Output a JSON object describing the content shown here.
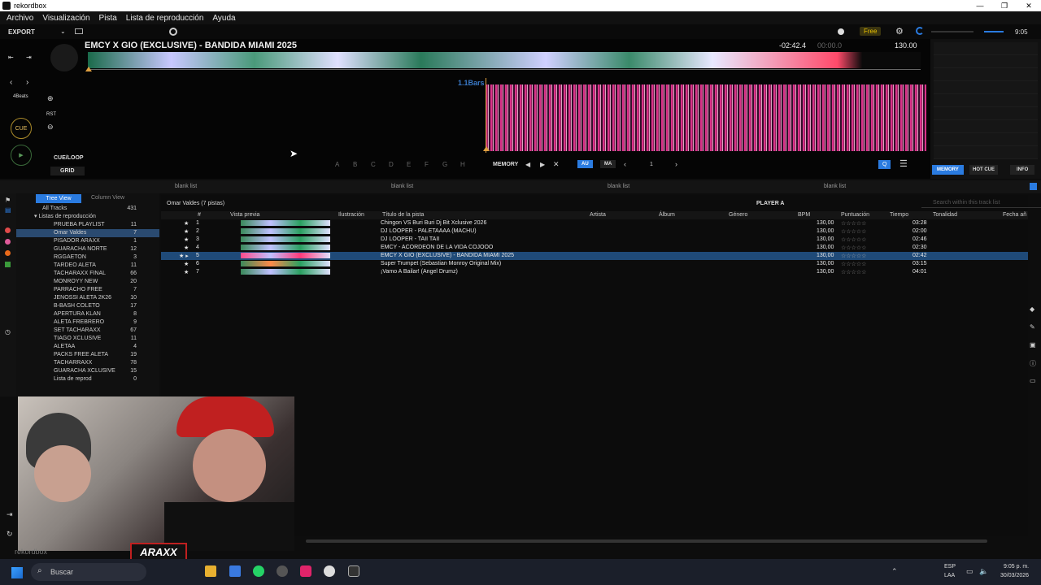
{
  "window": {
    "title": "rekordbox",
    "minimize": "—",
    "restore": "❐",
    "close": "✕"
  },
  "menu": [
    "Archivo",
    "Visualización",
    "Pista",
    "Lista de reproducción",
    "Ayuda"
  ],
  "topbar": {
    "export": "EXPORT",
    "free": "Free",
    "clock": "9:05"
  },
  "deck": {
    "track_title": "EMCY X GIO (EXCLUSIVE) - BANDIDA MIAMI 2025",
    "remaining": "-02:42.4",
    "elapsed": "00:00.0",
    "bpm": "130.00",
    "bars": "1.1Bars",
    "beats": "4Beats",
    "rst": "RST",
    "cue": "CUE",
    "cueloop": "CUE/LOOP",
    "grid": "GRID",
    "hotcues": [
      "A",
      "B",
      "C",
      "D",
      "E",
      "F",
      "G",
      "H"
    ],
    "memory": "MEMORY",
    "au": "AU",
    "ma": "MA",
    "page": "1"
  },
  "rightpanel": {
    "memory": "MEMORY",
    "hotcue": "HOT CUE",
    "info": "INFO"
  },
  "lists": {
    "blank": "blank list"
  },
  "tree": {
    "tree_view": "Tree View",
    "column_view": "Column View",
    "all_tracks": "All Tracks",
    "all_tracks_count": "431",
    "playlists_header": "Listas de reproducción",
    "items": [
      {
        "name": "PRUEBA PLAYLIST",
        "count": "11"
      },
      {
        "name": "Omar Valdes",
        "count": "7"
      },
      {
        "name": "PISADOR ARAXX",
        "count": "1"
      },
      {
        "name": "GUARACHA NORTE",
        "count": "12"
      },
      {
        "name": "RGGAETON",
        "count": "3"
      },
      {
        "name": "TARDEO ALETA",
        "count": "11"
      },
      {
        "name": "TACHARAXX FINAL",
        "count": "66"
      },
      {
        "name": "MONROYY NEW",
        "count": "20"
      },
      {
        "name": "PARRACHO FREE",
        "count": "7"
      },
      {
        "name": "JENOSSI ALETA 2K26",
        "count": "10"
      },
      {
        "name": "B-BASH COLETO",
        "count": "17"
      },
      {
        "name": "APERTURA KLAN",
        "count": "8"
      },
      {
        "name": "ALETA FREBRERO",
        "count": "9"
      },
      {
        "name": "SET TACHARAXX",
        "count": "67"
      },
      {
        "name": "TIAGO XCLUSIVE",
        "count": "11"
      },
      {
        "name": "ALETAA",
        "count": "4"
      },
      {
        "name": "PACKS FREE ALETA",
        "count": "19"
      },
      {
        "name": "TACHARRAXX",
        "count": "78"
      },
      {
        "name": "GUARACHA XCLUSIVE",
        "count": "15"
      },
      {
        "name": "Lista de reprod",
        "count": "0"
      }
    ]
  },
  "tracklist": {
    "header": "Omar Valdes (7 pistas)",
    "player": "PLAYER A",
    "search_placeholder": "Search within this track list",
    "columns": [
      "#",
      "Vista previa",
      "Ilustración",
      "Título de la pista",
      "Artista",
      "Álbum",
      "Género",
      "BPM",
      "Puntuación",
      "Tiempo",
      "Tonalidad",
      "Fecha añ"
    ],
    "rows": [
      {
        "n": "1",
        "title": "Chingon VS Buri Buri Dj Bit Xclusive 2026",
        "bpm": "130,00",
        "time": "03:28"
      },
      {
        "n": "2",
        "title": "DJ LOOPER - PALETAAAA (MACHU)",
        "bpm": "130,00",
        "time": "02:00"
      },
      {
        "n": "3",
        "title": "DJ LOOPER - TAII TAII",
        "bpm": "130,00",
        "time": "02:46"
      },
      {
        "n": "4",
        "title": "EMCY - ACORDEON DE LA VIDA COJOOO",
        "bpm": "130,00",
        "time": "02:30"
      },
      {
        "n": "5",
        "title": "EMCY X GIO (EXCLUSIVE) - BANDIDA MIAMI 2025",
        "bpm": "130,00",
        "time": "02:42"
      },
      {
        "n": "6",
        "title": "Super Trumpet (Sebastian Monroy Original Mix)",
        "bpm": "130,00",
        "time": "03:15"
      },
      {
        "n": "7",
        "title": "¡Vamo A Bailar! (Angel Drumz)",
        "bpm": "130,00",
        "time": "04:01"
      }
    ]
  },
  "bottom_logo": "rekordbox",
  "taskbar": {
    "search": "Buscar",
    "lang1": "ESP",
    "lang2": "LAA",
    "time": "9:05 p. m.",
    "date": "30/03/2026"
  }
}
